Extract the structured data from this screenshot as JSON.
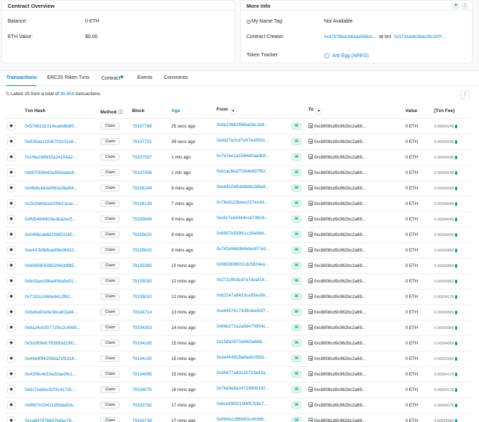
{
  "overview": {
    "title": "Contract Overview",
    "balance_label": "Balance:",
    "balance_value": "0 ETH",
    "eth_value_label": "ETH Value:",
    "eth_value_value": "$0.00"
  },
  "more_info": {
    "title": "More Info",
    "name_tag_label": "My Name Tag:",
    "name_tag_value": "Not Available",
    "creator_label": "Contract Creator:",
    "creator_address": "0xd7878bdcb6aae569dc...",
    "creator_at_txn": "at txn",
    "creator_txn": "0x3728ab628eb29c297f...",
    "token_tracker_label": "Token Tracker:",
    "token_tracker_value": "Arb Egg (AREG)"
  },
  "tabs": [
    {
      "label": "Transactions"
    },
    {
      "label": "ERC20 Token Txns"
    },
    {
      "label": "Contract"
    },
    {
      "label": "Events"
    },
    {
      "label": "Comments"
    }
  ],
  "summary": {
    "prefix": "Latest 25 from a total of",
    "count": "96,654",
    "suffix": "transactions"
  },
  "more_menu_glyph": "⋮",
  "table": {
    "headers": {
      "hash": "Txn Hash",
      "method": "Method",
      "block": "Block",
      "age": "Age",
      "from": "From",
      "to": "To",
      "value": "Value",
      "fee": "[Txn Fee]"
    },
    "rows": [
      {
        "hash": "0x5788182314eade8b80...",
        "method": "Claim",
        "block": "79197788",
        "age": "25 secs ago",
        "from": "0x9b10662f668a5dc1b8...",
        "dir": "IN",
        "to": "0xc8808cd9c962bc2a69...",
        "value": "0 ETH",
        "fee": "0.00004248"
      },
      {
        "hash": "0x935da119367031014d...",
        "method": "Claim",
        "block": "79197731",
        "age": "39 secs ago",
        "from": "0xdd27e2cd7e07ea560c...",
        "dir": "IN",
        "to": "0xc8808cd9c962bc2a69...",
        "value": "0 ETH",
        "fee": "0.00004248"
      },
      {
        "hash": "0x1f4e1b9b32a24154a2...",
        "method": "Claim",
        "block": "79197597",
        "age": "1 min ago",
        "from": "0x7e7ee1a1566b0aadb8...",
        "dir": "IN",
        "to": "0xc8808cd9c962bc2a69...",
        "value": "0 ETH",
        "fee": "0.00004248"
      },
      {
        "hash": "0xb67006942e455babe8...",
        "method": "Claim",
        "block": "79197456",
        "age": "1 min ago",
        "from": "0xd1ac6bd7f264b697f62...",
        "dir": "IN",
        "to": "0xc8808cd9c962bc2a69...",
        "value": "0 ETH",
        "fee": "0.00004248"
      },
      {
        "hash": "0xf4b6c4d3e5f62e3bd64...",
        "method": "Claim",
        "block": "79196244",
        "age": "6 mins ago",
        "from": "0xeb41049dd8b8e288a8...",
        "dir": "IN",
        "to": "0xc8808cd9c962bc2a69...",
        "value": "0 ETH",
        "fee": "0.00004049"
      },
      {
        "hash": "0x2b2b84a1dc09b21eac...",
        "method": "Claim",
        "block": "79196139",
        "age": "7 mins ago",
        "from": "0x7fed123beee227ec4d...",
        "dir": "IN",
        "to": "0xc8808cd9c962bc2a69...",
        "value": "0 ETH",
        "fee": "0.00004049"
      },
      {
        "hash": "0xffd5484f619edba2ec5...",
        "method": "Claim",
        "block": "79195649",
        "age": "9 mins ago",
        "from": "0xc8c7ee8444ccb7d816...",
        "dir": "IN",
        "to": "0xc8808cd9c962bc2a69...",
        "value": "0 ETH",
        "fee": "0.00004049"
      },
      {
        "hash": "0x0486cab681f9653165...",
        "method": "Claim",
        "block": "79195620",
        "age": "9 mins ago",
        "from": "0x8907e599fc1c34a96d...",
        "dir": "IN",
        "to": "0xc8808cd9c962bc2a69...",
        "value": "0 ETH",
        "fee": "0.00004049"
      },
      {
        "hash": "0xe447b5bfead0fe08422...",
        "method": "Claim",
        "block": "79195610",
        "age": "9 mins ago",
        "from": "0x742e56dd64ebed07ad...",
        "dir": "IN",
        "to": "0xc8808cd9c962bc2a69...",
        "value": "0 ETH",
        "fee": "0.00003869"
      },
      {
        "hash": "0x99459059952942bff85...",
        "method": "Claim",
        "block": "79195390",
        "age": "10 mins ago",
        "from": "0x9b59096011dc5924ea...",
        "dir": "IN",
        "to": "0xc8808cd9c962bc2a69...",
        "value": "0 ETH",
        "fee": "0.00003869"
      },
      {
        "hash": "0xbc5aec58ba408a9e51...",
        "method": "Claim",
        "block": "79195030",
        "age": "12 mins ago",
        "from": "0x272c993ed7e7deaf18...",
        "dir": "IN",
        "to": "0xc8808cd9c962bc2a69...",
        "value": "0 ETH",
        "fee": "0.00003962"
      },
      {
        "hash": "0x7152cc98ded413f62...",
        "method": "Claim",
        "block": "79195010",
        "age": "12 mins ago",
        "from": "0x62247a9433ca95ea5b...",
        "dir": "IN",
        "to": "0xc8808cd9c962bc2a69...",
        "value": "0 ETH",
        "fee": "0.00004178"
      },
      {
        "hash": "0x0e6a50e9e3dca62ad4...",
        "method": "Claim",
        "block": "79194714",
        "age": "13 mins ago",
        "from": "0xa945761743fb3ee50f7...",
        "dir": "IN",
        "to": "0xc8808cd9c962bc2a69...",
        "value": "0 ETH",
        "fee": "0.00003989"
      },
      {
        "hash": "0x8a24c020771f5c2c4080...",
        "method": "Claim",
        "block": "79194353",
        "age": "14 mins ago",
        "from": "0x6bb271a2a8de70854c...",
        "dir": "IN",
        "to": "0xc8808cd9c962bc2a69...",
        "value": "0 ETH",
        "fee": "0.00003989"
      },
      {
        "hash": "0x3d3f0fefc793993d33f0...",
        "method": "Claim",
        "block": "79194195",
        "age": "15 mins ago",
        "from": "0x1fafa2970af463a6b8...",
        "dir": "IN",
        "to": "0xc8808cd9c962bc2a69...",
        "value": "0 ETH",
        "fee": "0.00004069"
      },
      {
        "hash": "0x44d4f9420b9a21f5318...",
        "method": "Claim",
        "block": "79194150",
        "age": "15 mins ago",
        "from": "0x3e464918a8ae5cfb5b...",
        "dir": "IN",
        "to": "0xc8808cd9c962bc2a69...",
        "value": "0 ETH",
        "fee": "0.00003989"
      },
      {
        "hash": "0x4308c4d16a33ae0fe1...",
        "method": "Claim",
        "block": "79194095",
        "age": "15 mins ago",
        "from": "0x35677a40c25723e43a...",
        "dir": "IN",
        "to": "0xc8808cd9c962bc2a69...",
        "value": "0 ETH",
        "fee": "0.00004178"
      },
      {
        "hash": "0xd17ea8ec92f3c417d1...",
        "method": "Claim",
        "block": "79194075",
        "age": "16 mins ago",
        "from": "0x7bd3eba24729906182...",
        "dir": "IN",
        "to": "0xc8808cd9c962bc2a69...",
        "value": "0 ETH",
        "fee": "0.00004178"
      },
      {
        "hash": "0x8607c03411d5bda5cb...",
        "method": "Claim",
        "block": "79193782",
        "age": "17 mins ago",
        "from": "0x6ce490f21f46f57b8c7...",
        "dir": "IN",
        "to": "0xc8808cd9c962bc2a69...",
        "value": "0 ETH",
        "fee": "0.00004178"
      },
      {
        "hash": "0x1a847678d37b8ac78...",
        "method": "Claim",
        "block": "79193738",
        "age": "17 mins ago",
        "from": "0x09f4cc3f6fe63c4fc6f8...",
        "dir": "IN",
        "to": "0xc8808cd9c962bc2a69...",
        "value": "0 ETH",
        "fee": "0.00003989"
      }
    ]
  }
}
